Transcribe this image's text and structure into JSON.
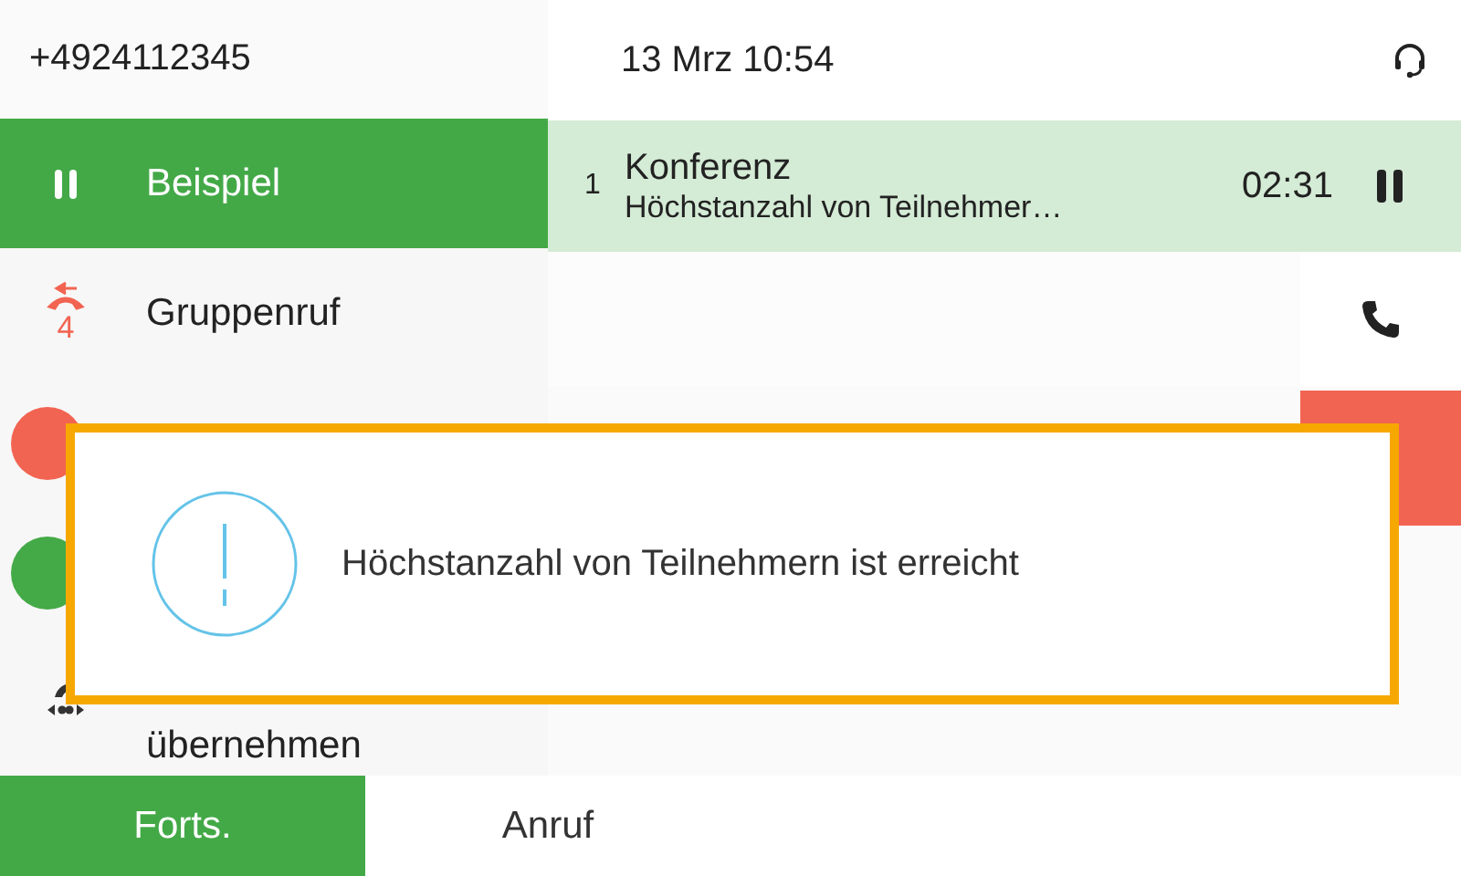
{
  "header": {
    "line_number": "+4924112345",
    "datetime": "13 Mrz 10:54"
  },
  "lines": [
    {
      "kind": "held",
      "label": "Beispiel",
      "selected": true
    },
    {
      "kind": "group",
      "label": "Gruppenruf",
      "count": "4",
      "selected": false
    },
    {
      "kind": "avatar",
      "color": "#f26452",
      "selected": false
    },
    {
      "kind": "avatar",
      "color": "#44aa47",
      "selected": false
    },
    {
      "kind": "pickup",
      "label": "übernehmen",
      "selected": false
    }
  ],
  "call": {
    "index": "1",
    "title": "Konferenz",
    "subtitle": "Höchstanzahl von Teilnehmer…",
    "duration": "02:31"
  },
  "actions": [
    {
      "kind": "answer"
    },
    {
      "kind": "end"
    }
  ],
  "alert": {
    "message": "Höchstanzahl von Teilnehmern ist erreicht"
  },
  "softkeys": [
    {
      "label": "Forts.",
      "selected": true
    },
    {
      "label": "Anruf",
      "selected": false
    }
  ]
}
